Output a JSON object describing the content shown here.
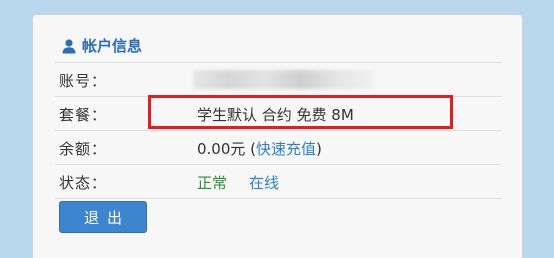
{
  "header": {
    "title": "帐户信息",
    "icon": "user-icon"
  },
  "rows": {
    "account": {
      "label": "账号：",
      "value": ""
    },
    "plan": {
      "label": "套餐：",
      "value": "学生默认 合约 免费 8M"
    },
    "balance": {
      "label": "余额：",
      "amount": "0.00元",
      "open_paren": " (",
      "recharge_link": "快速充值",
      "close_paren": ")"
    },
    "status": {
      "label": "状态：",
      "state": "正常",
      "online": "在线"
    }
  },
  "actions": {
    "logout_label": "退出"
  },
  "colors": {
    "accent": "#2f6db5",
    "link": "#2f80c3",
    "ok": "#2e8b3a",
    "highlight": "#e02020",
    "button": "#3d86cf"
  }
}
